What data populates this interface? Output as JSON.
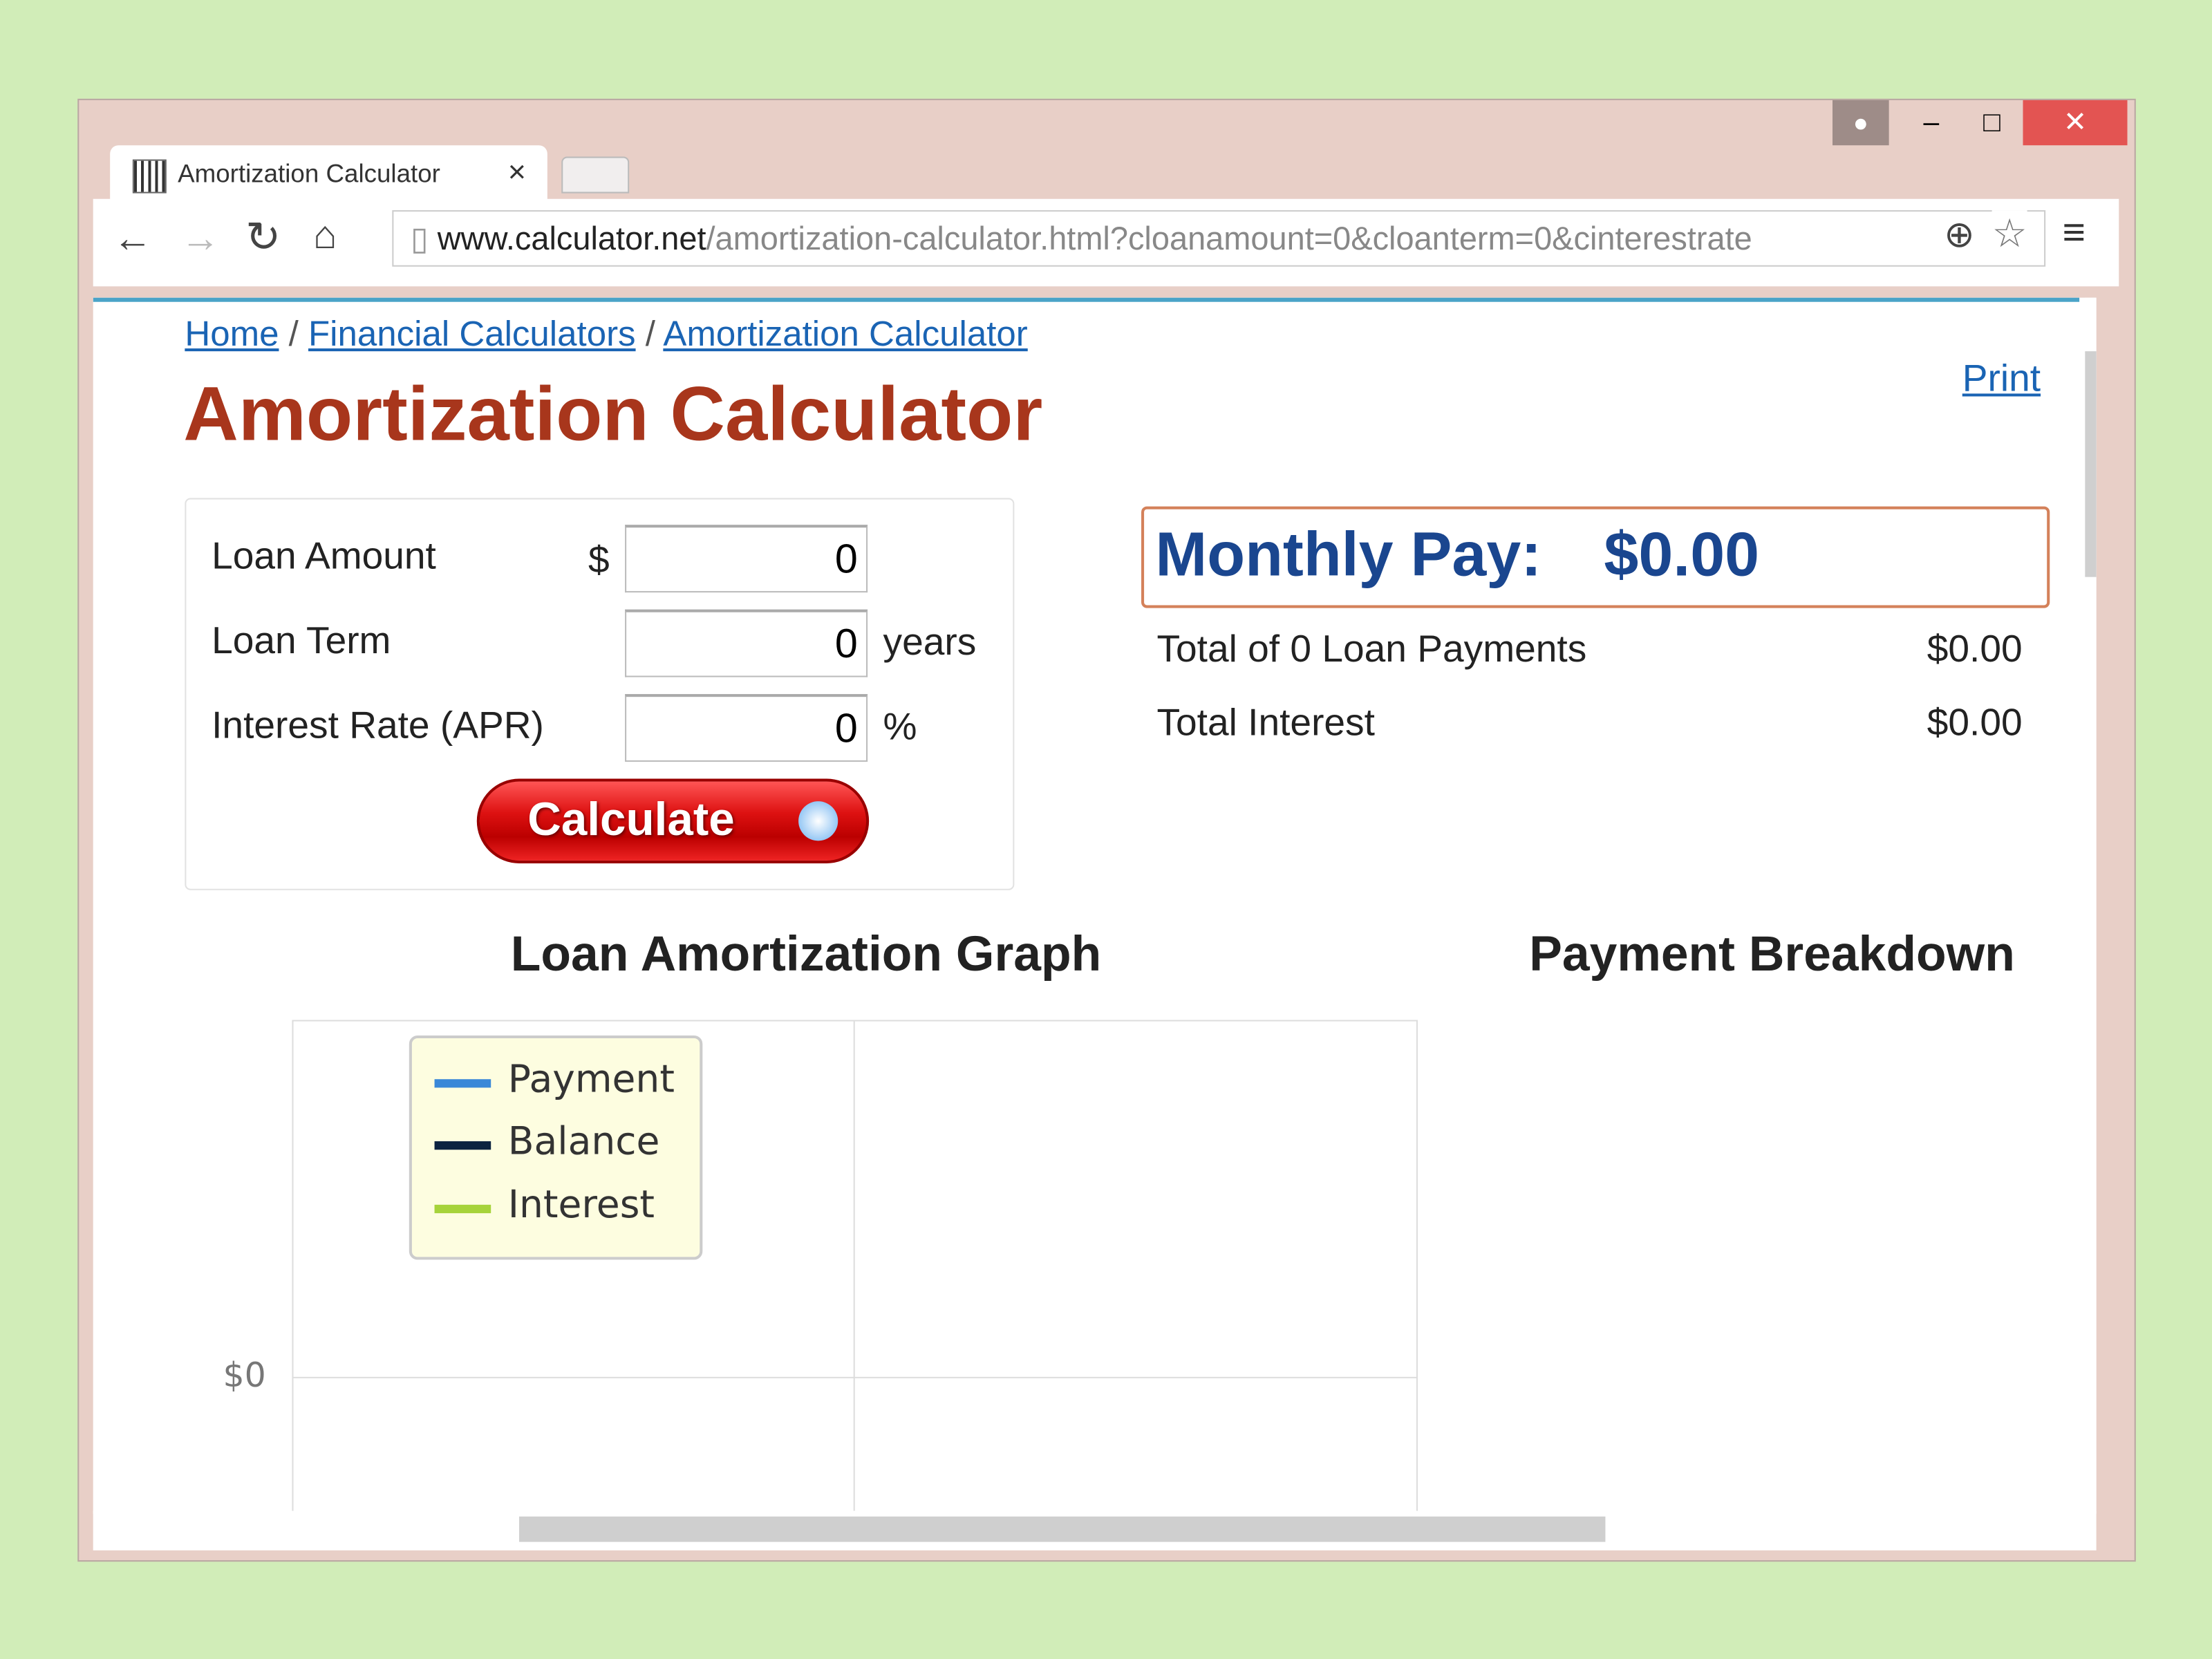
{
  "window": {
    "tab_title": "Amortization Calculator",
    "close_tab": "×",
    "controls": {
      "minimize": "–",
      "maximize": "□",
      "close": "✕"
    }
  },
  "toolbar": {
    "url_domain": "www.calculator.net",
    "url_path": "/amortization-calculator.html?cloanamount=0&cloanterm=0&cinterestrate"
  },
  "breadcrumb": {
    "items": [
      "Home",
      "Financial Calculators",
      "Amortization Calculator"
    ],
    "sep": "/"
  },
  "print": "Print",
  "title": "Amortization Calculator",
  "form": {
    "loan_amount_label": "Loan Amount",
    "currency": "$",
    "loan_amount": "0",
    "loan_term_label": "Loan Term",
    "loan_term": "0",
    "term_unit": "years",
    "rate_label": "Interest Rate (APR)",
    "rate": "0",
    "rate_unit": "%",
    "calculate": "Calculate"
  },
  "results": {
    "monthly_label": "Monthly Pay:",
    "monthly_value": "$0.00",
    "rows": [
      {
        "label": "Total of 0 Loan Payments",
        "value": "$0.00"
      },
      {
        "label": "Total Interest",
        "value": "$0.00"
      }
    ]
  },
  "graph": {
    "title": "Loan Amortization Graph",
    "legend": [
      {
        "label": "Payment",
        "color": "#3a88d8"
      },
      {
        "label": "Balance",
        "color": "#0c2340"
      },
      {
        "label": "Interest",
        "color": "#a6d33a"
      }
    ],
    "y_tick": "$0"
  },
  "breakdown": {
    "title": "Payment Breakdown"
  }
}
